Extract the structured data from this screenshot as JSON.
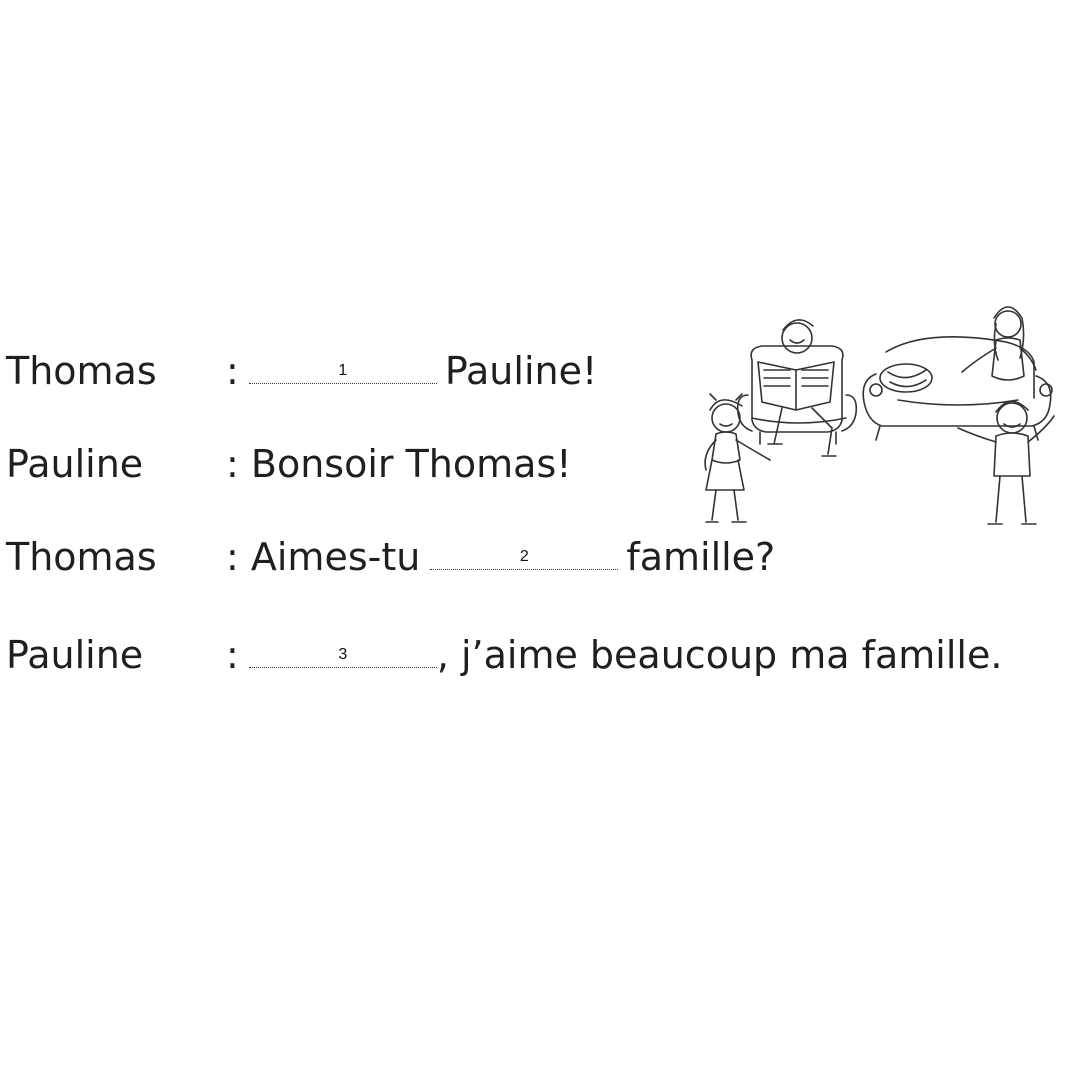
{
  "dialogue": [
    {
      "speaker": "Thomas",
      "before": ":",
      "blank": "1",
      "after": "Pauline!"
    },
    {
      "speaker": "Pauline",
      "text": ": Bonsoir Thomas!"
    },
    {
      "speaker": "Thomas",
      "before": ": Aimes-tu",
      "blank": "2",
      "after": "famille?"
    },
    {
      "speaker": "Pauline",
      "before": ":",
      "blank": "3",
      "after": ", j’aime beaucoup ma famille."
    }
  ],
  "illustration": {
    "icon": "family-living-room-illustration"
  }
}
